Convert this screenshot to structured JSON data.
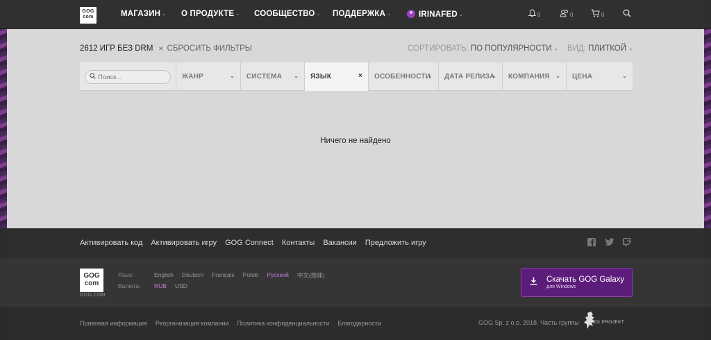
{
  "header": {
    "logo_top": "GOG",
    "logo_bottom": "com",
    "nav": [
      {
        "label": "МАГАЗИН"
      },
      {
        "label": "О ПРОДУКТЕ"
      },
      {
        "label": "СООБЩЕСТВО"
      },
      {
        "label": "ПОДДЕРЖКА"
      }
    ],
    "user": "IRINAFED",
    "notifications_count": "0",
    "friends_count": "0",
    "cart_count": "0"
  },
  "catalog": {
    "count_text": "2612 ИГР БЕЗ DRM",
    "reset_label": "СБРОСИТЬ ФИЛЬТРЫ",
    "sort_prefix": "СОРТИРОВАТЬ:",
    "sort_value": "ПО ПОПУЛЯРНОСТИ",
    "view_prefix": "ВИД:",
    "view_value": "ПЛИТКОЙ",
    "search_placeholder": "Поиск...",
    "filters": [
      {
        "label": "ЖАНР"
      },
      {
        "label": "СИСТЕМА"
      },
      {
        "label": "ЯЗЫК"
      },
      {
        "label": "ОСОБЕННОСТИ"
      },
      {
        "label": "ДАТА РЕЛИЗА"
      },
      {
        "label": "КОМПАНИЯ"
      },
      {
        "label": "ЦЕНА"
      }
    ],
    "empty_message": "Ничего не найдено"
  },
  "footer": {
    "links": [
      "Активировать код",
      "Активировать игру",
      "GOG Connect",
      "Контакты",
      "Вакансии",
      "Предложить игру"
    ],
    "logo_caption": "GOG.COM",
    "language_label": "Язык:",
    "currency_label": "Валюта:",
    "languages": [
      "English",
      "Deutsch",
      "Français",
      "Polski",
      "Русский",
      "中文(简体)"
    ],
    "currencies": [
      "RUB",
      "USD"
    ],
    "galaxy_title": "Скачать GOG Galaxy",
    "galaxy_sub": "для Windows",
    "legal": [
      "Правовая информация",
      "Реорганизация компании",
      "Политика конфиденциальности",
      "Благодарности"
    ],
    "copyright": "GOG Sp. z o.o. 2018. Часть группы",
    "cdp_text": "CD PROJEKT",
    "accent": "#9b3fc1"
  }
}
